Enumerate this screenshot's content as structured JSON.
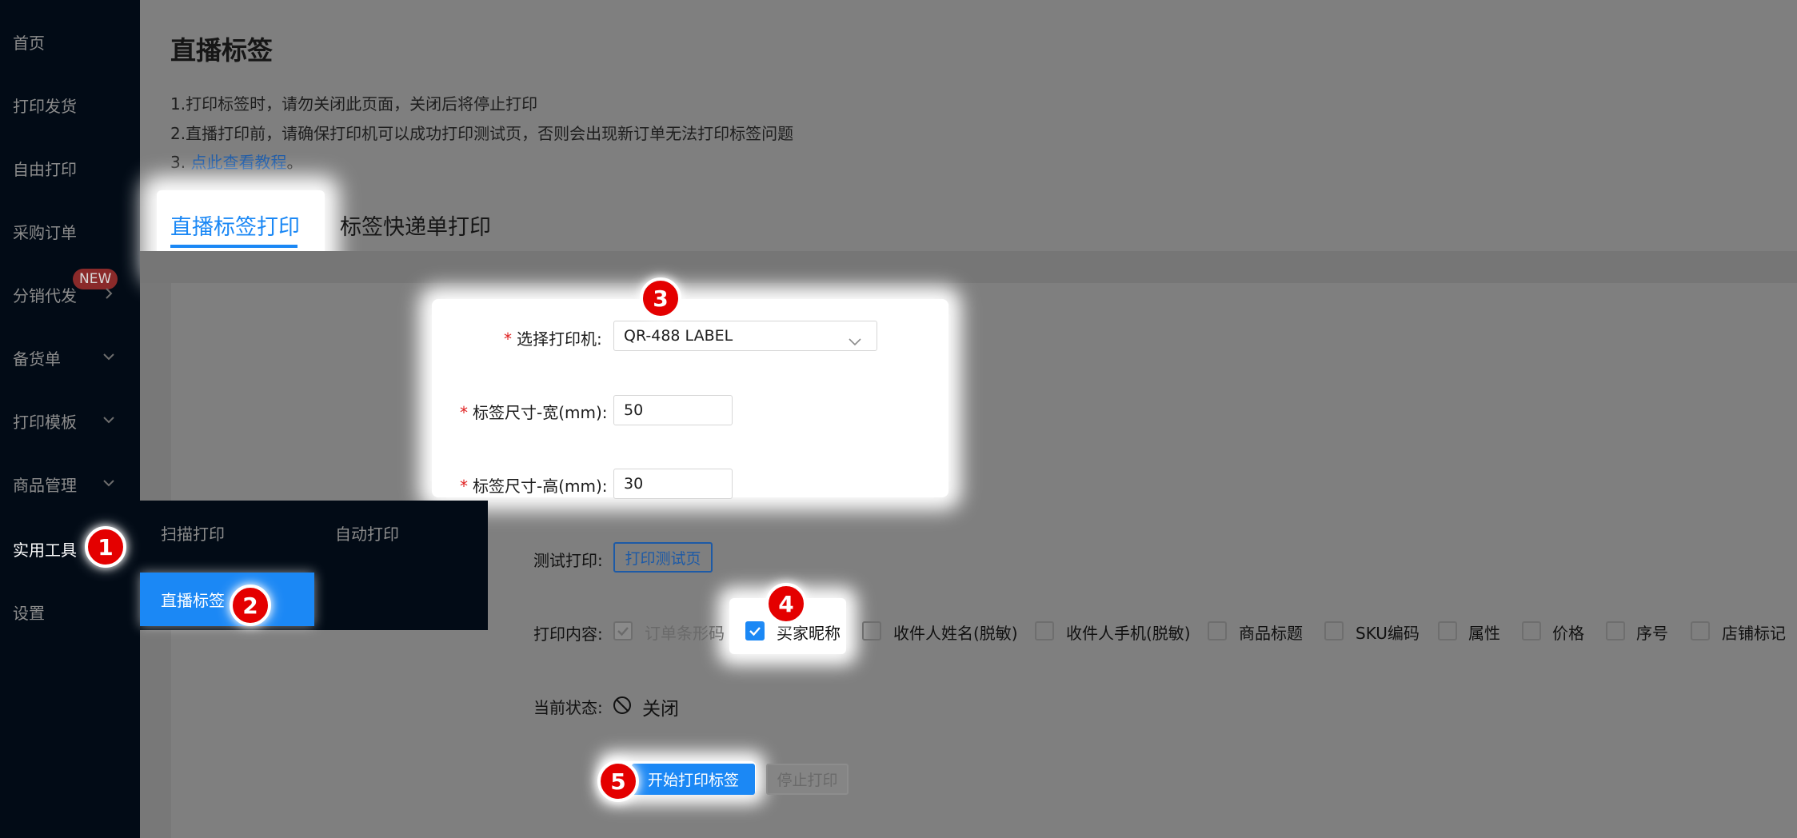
{
  "sidebar": {
    "items": [
      {
        "label": "首页"
      },
      {
        "label": "打印发货"
      },
      {
        "label": "自由打印"
      },
      {
        "label": "采购订单"
      },
      {
        "label": "分销代发",
        "badge": "NEW"
      },
      {
        "label": "备货单"
      },
      {
        "label": "打印模板"
      },
      {
        "label": "商品管理"
      },
      {
        "label": "实用工具"
      },
      {
        "label": "设置"
      }
    ]
  },
  "submenu": {
    "items": [
      "扫描打印",
      "自动打印"
    ],
    "active": "直播标签"
  },
  "markers": [
    "1",
    "2",
    "3",
    "4",
    "5"
  ],
  "page": {
    "title": "直播标签",
    "notices": {
      "line1": "1.打印标签时，请勿关闭此页面，关闭后将停止打印",
      "line2": "2.直播打印前，请确保打印机可以成功打印测试页，否则会出现新订单无法打印标签问题",
      "line3_prefix": "3. ",
      "line3_link": "点此查看教程",
      "line3_suffix": "。"
    }
  },
  "tabs": {
    "active": "直播标签打印",
    "other": "标签快递单打印"
  },
  "form": {
    "printer_label": "选择打印机:",
    "printer_value": "QR-488 LABEL",
    "width_label": "标签尺寸-宽(mm):",
    "width_value": "50",
    "height_label": "标签尺寸-高(mm):",
    "height_value": "30",
    "test_label": "测试打印:",
    "test_button": "打印测试页",
    "content_label": "打印内容:",
    "content_options": [
      {
        "label": "订单条形码",
        "state": "checked-disabled"
      },
      {
        "label": "买家昵称",
        "state": "checked"
      },
      {
        "label": "收件人姓名(脱敏)",
        "state": "unchecked"
      },
      {
        "label": "收件人手机(脱敏)",
        "state": "unchecked"
      },
      {
        "label": "商品标题",
        "state": "unchecked"
      },
      {
        "label": "SKU编码",
        "state": "unchecked"
      },
      {
        "label": "属性",
        "state": "unchecked"
      },
      {
        "label": "价格",
        "state": "unchecked"
      },
      {
        "label": "序号",
        "state": "unchecked"
      },
      {
        "label": "店铺标记",
        "state": "unchecked"
      }
    ],
    "status_label": "当前状态:",
    "status_value": "关闭",
    "start_button": "开始打印标签",
    "stop_button": "停止打印"
  },
  "colors": {
    "accent": "#1b88f5",
    "sidebar_bg": "#020b16",
    "marker": "#e40000"
  }
}
